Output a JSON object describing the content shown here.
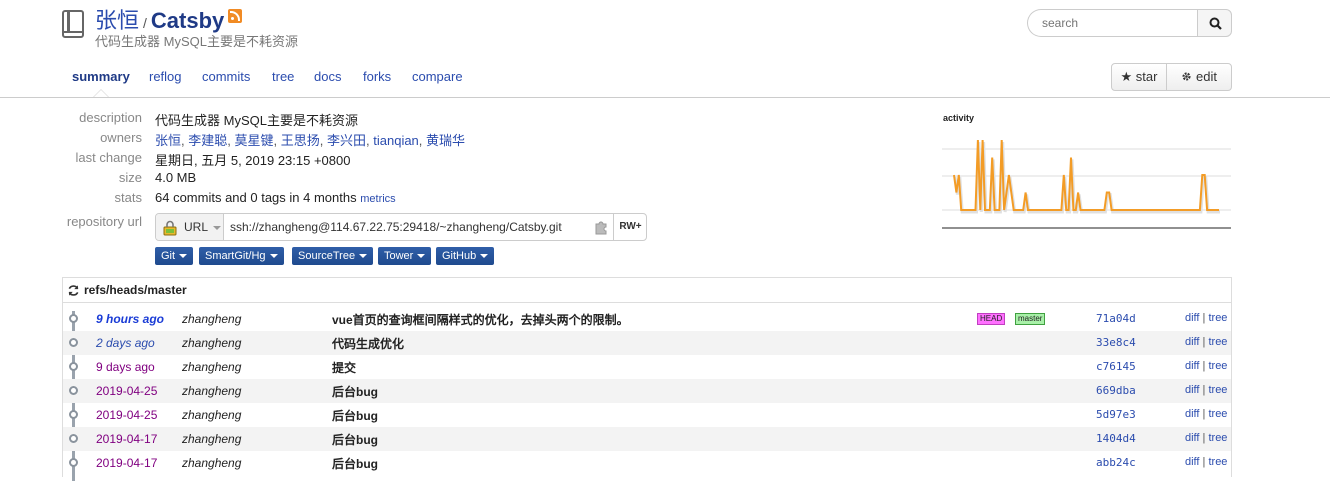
{
  "header": {
    "owner": "张恒",
    "slash": "/",
    "repo": "Catsby",
    "subtitle": "代码生成器 MySQL主要是不耗资源"
  },
  "search": {
    "placeholder": "search"
  },
  "nav": {
    "tabs": [
      {
        "label": "summary",
        "active": true
      },
      {
        "label": "reflog"
      },
      {
        "label": "commits"
      },
      {
        "label": "tree"
      },
      {
        "label": "docs"
      },
      {
        "label": "forks"
      },
      {
        "label": "compare"
      }
    ],
    "star_label": "★ star",
    "edit_label": "edit"
  },
  "summary": {
    "description_label": "description",
    "description": "代码生成器 MySQL主要是不耗资源",
    "owners_label": "owners",
    "owners": [
      "张恒",
      "李建聪",
      "莫星键",
      "王思扬",
      "李兴田",
      "tianqian",
      "黄瑞华"
    ],
    "last_change_label": "last change",
    "last_change": "星期日, 五月 5, 2019 23:15 +0800",
    "size_label": "size",
    "size": "4.0 MB",
    "stats_label": "stats",
    "stats": "64 commits and 0 tags in 4 months",
    "metrics_link": "metrics",
    "repo_url_label": "repository url",
    "url_type": "URL",
    "url": "ssh://zhangheng@114.67.22.75:29418/~zhangheng/Catsby.git",
    "permission": "RW+",
    "clients": [
      "Git",
      "SmartGit/Hg",
      "SourceTree",
      "Tower",
      "GitHub"
    ]
  },
  "activity": {
    "title": "activity",
    "line_color": "#f39c26",
    "values": [
      2,
      1,
      2,
      0,
      0,
      0,
      0,
      0,
      0,
      0,
      4,
      0,
      4,
      0,
      0,
      0,
      3,
      0,
      0,
      0,
      4,
      0,
      1,
      2,
      1,
      0,
      0,
      0,
      0,
      0,
      1,
      0,
      0,
      0,
      0,
      0,
      0,
      0,
      0,
      0,
      0,
      0,
      0,
      0,
      0,
      0,
      2,
      0,
      0,
      3,
      0,
      0,
      1,
      0,
      0,
      0,
      0,
      0,
      0,
      0,
      0,
      0,
      0,
      0,
      1,
      1,
      0,
      0,
      0,
      0,
      0,
      0,
      0,
      0,
      0,
      0,
      0,
      0,
      0,
      0,
      0,
      0,
      0,
      0,
      0,
      0,
      0,
      0,
      0,
      0,
      0,
      0,
      0,
      0,
      0,
      0,
      0,
      0,
      0,
      0,
      0,
      0,
      0,
      0,
      2,
      2,
      0,
      0,
      0,
      0,
      0,
      0
    ]
  },
  "log": {
    "ref": "refs/heads/master",
    "head_badge": "HEAD",
    "branch_badge": "master",
    "diff_label": "diff",
    "tree_label": "tree",
    "link_sep": "|",
    "commits": [
      {
        "date": "9 hours ago",
        "style": "recent",
        "author": "zhangheng",
        "message": "vue首页的查询框间隔样式的优化，去掉头两个的限制。",
        "hash": "71a04d",
        "head": true
      },
      {
        "date": "2 days ago",
        "style": "near",
        "author": "zhangheng",
        "message": "代码生成优化",
        "hash": "33e8c4"
      },
      {
        "date": "9 days ago",
        "style": "old",
        "author": "zhangheng",
        "message": "提交",
        "hash": "c76145"
      },
      {
        "date": "2019-04-25",
        "style": "old",
        "author": "zhangheng",
        "message": "后台bug",
        "hash": "669dba"
      },
      {
        "date": "2019-04-25",
        "style": "old",
        "author": "zhangheng",
        "message": "后台bug",
        "hash": "5d97e3"
      },
      {
        "date": "2019-04-17",
        "style": "old",
        "author": "zhangheng",
        "message": "后台bug",
        "hash": "1404d4"
      },
      {
        "date": "2019-04-17",
        "style": "old",
        "author": "zhangheng",
        "message": "后台bug",
        "hash": "abb24c"
      }
    ]
  }
}
